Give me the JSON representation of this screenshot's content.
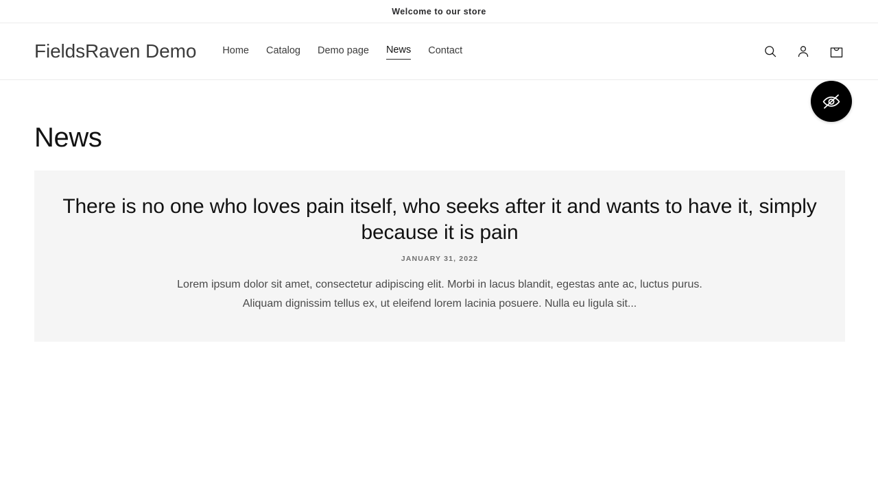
{
  "announcement": {
    "text": "Welcome to our store"
  },
  "header": {
    "logo": "FieldsRaven Demo",
    "nav": [
      {
        "label": "Home",
        "active": false
      },
      {
        "label": "Catalog",
        "active": false
      },
      {
        "label": "Demo page",
        "active": false
      },
      {
        "label": "News",
        "active": true
      },
      {
        "label": "Contact",
        "active": false
      }
    ],
    "actions": {
      "search": "search-icon",
      "account": "account-icon",
      "cart": "cart-icon"
    },
    "accessibility_widget": {
      "icon": "eye-off-icon",
      "color": "#000000"
    }
  },
  "main": {
    "page_title": "News",
    "articles": [
      {
        "title": "There is no one who loves pain itself, who seeks after it and wants to have it, simply because it is pain",
        "date": "JANUARY 31, 2022",
        "excerpt_line_1": "Lorem ipsum dolor sit amet, consectetur adipiscing elit. Morbi in lacus blandit, egestas ante ac, luctus purus.",
        "excerpt_line_2": "Aliquam dignissim tellus ex, ut eleifend lorem lacinia posuere. Nulla eu ligula sit..."
      }
    ]
  },
  "theme": {
    "background": "#ffffff",
    "card_background": "#f5f5f5",
    "text": "#121212",
    "muted_text": "#6f6f6f",
    "border": "#ebebeb"
  }
}
